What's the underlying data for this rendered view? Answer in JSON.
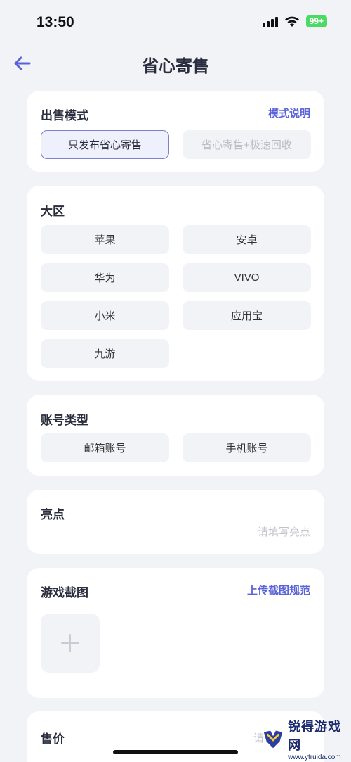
{
  "status": {
    "time": "13:50",
    "battery": "99+"
  },
  "header": {
    "title": "省心寄售"
  },
  "sale_mode": {
    "title": "出售模式",
    "link": "模式说明",
    "options": [
      {
        "label": "只发布省心寄售",
        "selected": true
      },
      {
        "label": "省心寄售+极速回收",
        "selected": false
      }
    ]
  },
  "region": {
    "title": "大区",
    "options": [
      "苹果",
      "安卓",
      "华为",
      "VIVO",
      "小米",
      "应用宝",
      "九游"
    ]
  },
  "account_type": {
    "title": "账号类型",
    "options": [
      "邮箱账号",
      "手机账号"
    ]
  },
  "highlight": {
    "title": "亮点",
    "placeholder": "请填写亮点"
  },
  "screenshots": {
    "title": "游戏截图",
    "link": "上传截图规范"
  },
  "price": {
    "title": "售价",
    "placeholder_partial": "请"
  },
  "watermark": {
    "name": "锐得游戏网",
    "url": "www.ytruida.com"
  },
  "colors": {
    "accent": "#5a63d8",
    "background": "#f2f3f7",
    "selected_border": "#7a80d6"
  }
}
